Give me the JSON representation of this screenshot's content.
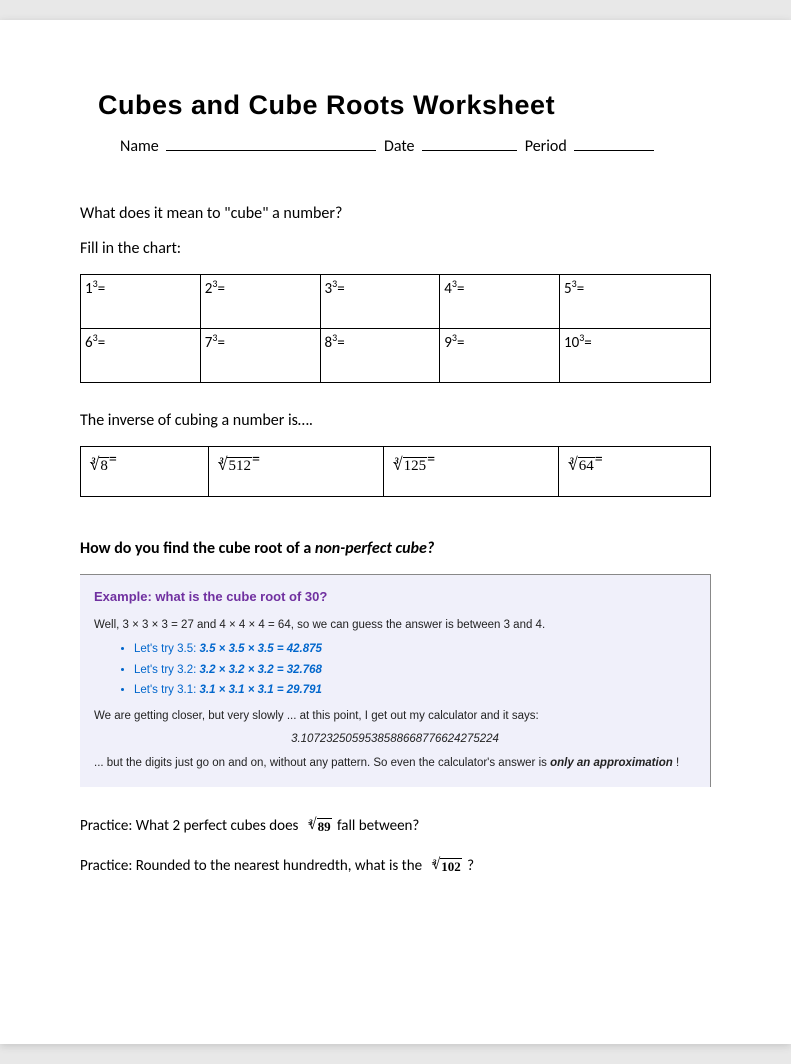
{
  "title": "Cubes and Cube Roots Worksheet",
  "header": {
    "name_label": "Name",
    "date_label": "Date",
    "period_label": "Period"
  },
  "prompt1": "What does it mean to \"cube\" a number?",
  "prompt2": "Fill in the chart:",
  "chart": [
    {
      "base": "1",
      "exp": "3"
    },
    {
      "base": "2",
      "exp": "3"
    },
    {
      "base": "3",
      "exp": "3"
    },
    {
      "base": "4",
      "exp": "3"
    },
    {
      "base": "5",
      "exp": "3"
    },
    {
      "base": "6",
      "exp": "3"
    },
    {
      "base": "7",
      "exp": "3"
    },
    {
      "base": "8",
      "exp": "3"
    },
    {
      "base": "9",
      "exp": "3"
    },
    {
      "base": "10",
      "exp": "3"
    }
  ],
  "prompt3": "The inverse of cubing a number is….",
  "roots": [
    {
      "index": "3",
      "radicand": "8"
    },
    {
      "index": "3",
      "radicand": "512"
    },
    {
      "index": "3",
      "radicand": "125"
    },
    {
      "index": "3",
      "radicand": "64"
    }
  ],
  "prompt4_prefix": "How do you find the cube root of a ",
  "prompt4_em": "non-perfect cube?",
  "example": {
    "title": "Example: what is the cube root of 30?",
    "line1": "Well, 3 × 3 × 3 = 27 and 4 × 4 × 4 = 64, so we can guess the answer is between 3 and 4.",
    "bullets": [
      {
        "prefix": "Let's try 3.5: ",
        "calc": "3.5 × 3.5 × 3.5 = 42.875"
      },
      {
        "prefix": "Let's try 3.2: ",
        "calc": "3.2 × 3.2 × 3.2 = 32.768"
      },
      {
        "prefix": "Let's try 3.1: ",
        "calc": "3.1 × 3.1 × 3.1 = 29.791"
      }
    ],
    "line2": "We are getting closer, but very slowly ... at this point, I get out my calculator and it says:",
    "result": "3.1072325059538588668776624275224",
    "line3_prefix": "... but the digits just go on and on, without any pattern. So even the calculator's answer is ",
    "line3_em": "only an approximation",
    "line3_suffix": " !"
  },
  "practice1_prefix": "Practice: What 2 perfect cubes does ",
  "practice1_root": {
    "index": "3",
    "radicand": "89"
  },
  "practice1_suffix": " fall between?",
  "practice2_prefix": "Practice: Rounded to the nearest hundredth, what is the ",
  "practice2_root": {
    "index": "3",
    "radicand": "102"
  },
  "practice2_suffix": "?"
}
